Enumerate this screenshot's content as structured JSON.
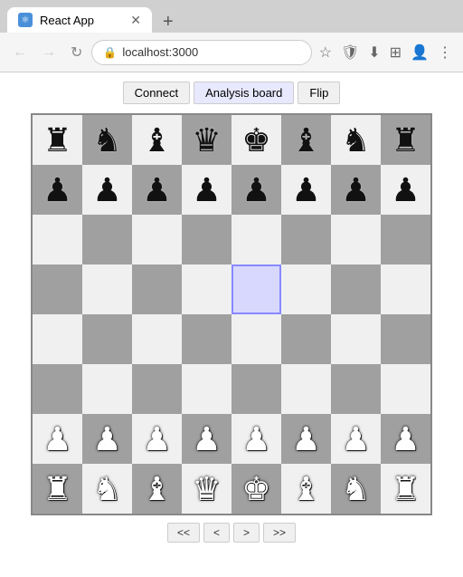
{
  "browser": {
    "tab_title": "React App",
    "tab_favicon": "⚛",
    "url": "localhost:3000",
    "new_tab_label": "+",
    "nav": {
      "back": "←",
      "forward": "→",
      "reload": "↺",
      "home": ""
    }
  },
  "toolbar": {
    "buttons": [
      {
        "id": "connect",
        "label": "Connect"
      },
      {
        "id": "analysis",
        "label": "Analysis board"
      },
      {
        "id": "flip",
        "label": "Flip"
      }
    ]
  },
  "board": {
    "highlighted_cell": "e5",
    "nav_buttons": [
      {
        "id": "first",
        "label": "<<"
      },
      {
        "id": "prev",
        "label": "<"
      },
      {
        "id": "next",
        "label": ">"
      },
      {
        "id": "last",
        "label": ">>"
      }
    ]
  },
  "icons": {
    "star": "☆",
    "extensions": "⊞",
    "profile": "👤",
    "menu": "⋮",
    "bookmark": "☆",
    "shields": "🛡",
    "download": "⬇",
    "lock": "🔒"
  }
}
